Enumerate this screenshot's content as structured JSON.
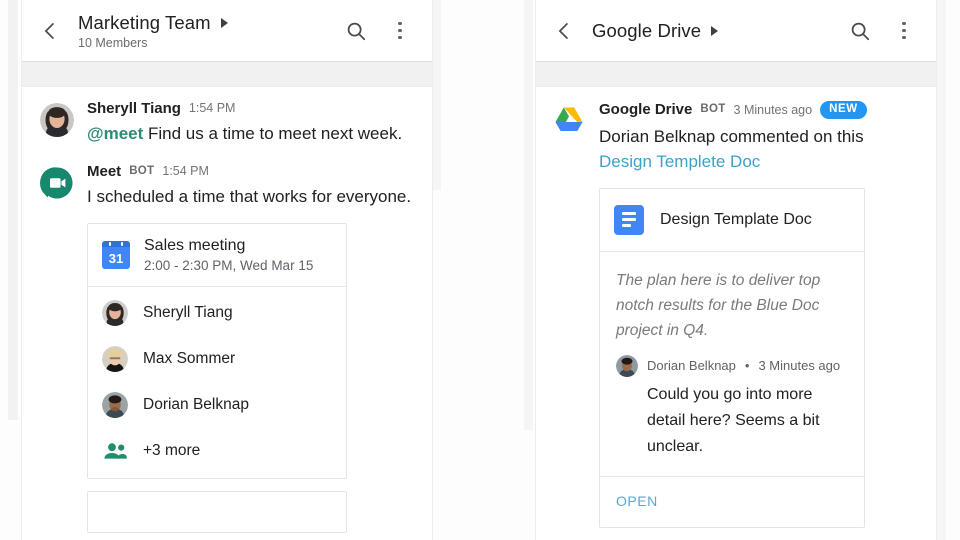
{
  "left_panel": {
    "header": {
      "back_icon": "chevron-left-icon",
      "title": "Marketing Team",
      "caret_icon": "caret-right-icon",
      "subtitle": "10 Members",
      "search_icon": "search-icon",
      "overflow_icon": "more-vertical-icon"
    },
    "messages": [
      {
        "avatar": "avatar-sheryll",
        "name": "Sheryll Tiang",
        "bot": "",
        "time": "1:54 PM",
        "mention": "@meet",
        "text": "Find us a time to meet next week."
      },
      {
        "avatar": "meet-bot-icon",
        "name": "Meet",
        "bot": "BOT",
        "time": "1:54 PM",
        "mention": "",
        "text": "I scheduled a time that works for everyone."
      }
    ],
    "meeting_card": {
      "calendar_icon": "google-calendar-icon",
      "calendar_day": "31",
      "title": "Sales meeting",
      "when": "2:00 - 2:30 PM, Wed Mar 15",
      "attendees": [
        {
          "avatar": "avatar-sheryll",
          "name": "Sheryll Tiang"
        },
        {
          "avatar": "avatar-max",
          "name": "Max Sommer"
        },
        {
          "avatar": "avatar-dorian",
          "name": "Dorian Belknap"
        }
      ],
      "more_icon": "people-icon",
      "more_label": "+3 more"
    }
  },
  "right_panel": {
    "header": {
      "back_icon": "chevron-left-icon",
      "title": "Google Drive",
      "caret_icon": "caret-right-icon",
      "search_icon": "search-icon",
      "overflow_icon": "more-vertical-icon"
    },
    "message": {
      "avatar": "google-drive-icon",
      "name": "Google Drive",
      "bot": "BOT",
      "time": "3 Minutes ago",
      "badge": "NEW",
      "text": "Dorian Belknap commented on this",
      "link": "Design Templete Doc"
    },
    "doc_card": {
      "doc_icon": "google-docs-icon",
      "title": "Design Template Doc",
      "quote": "The plan here is to deliver top notch results for the Blue Doc project in Q4.",
      "comment": {
        "avatar": "avatar-dorian",
        "author": "Dorian Belknap",
        "separator": "•",
        "time": "3 Minutes ago",
        "body": "Could you go into more detail here? Seems a bit unclear."
      },
      "open_label": "OPEN"
    }
  },
  "colors": {
    "accent_blue": "#4285f4",
    "badge_blue": "#2196f3",
    "link_blue": "#39a3c8",
    "mention_teal": "#2e8b74",
    "meet_green": "#17876d",
    "text_primary": "#202124",
    "text_secondary": "#5f6368"
  }
}
